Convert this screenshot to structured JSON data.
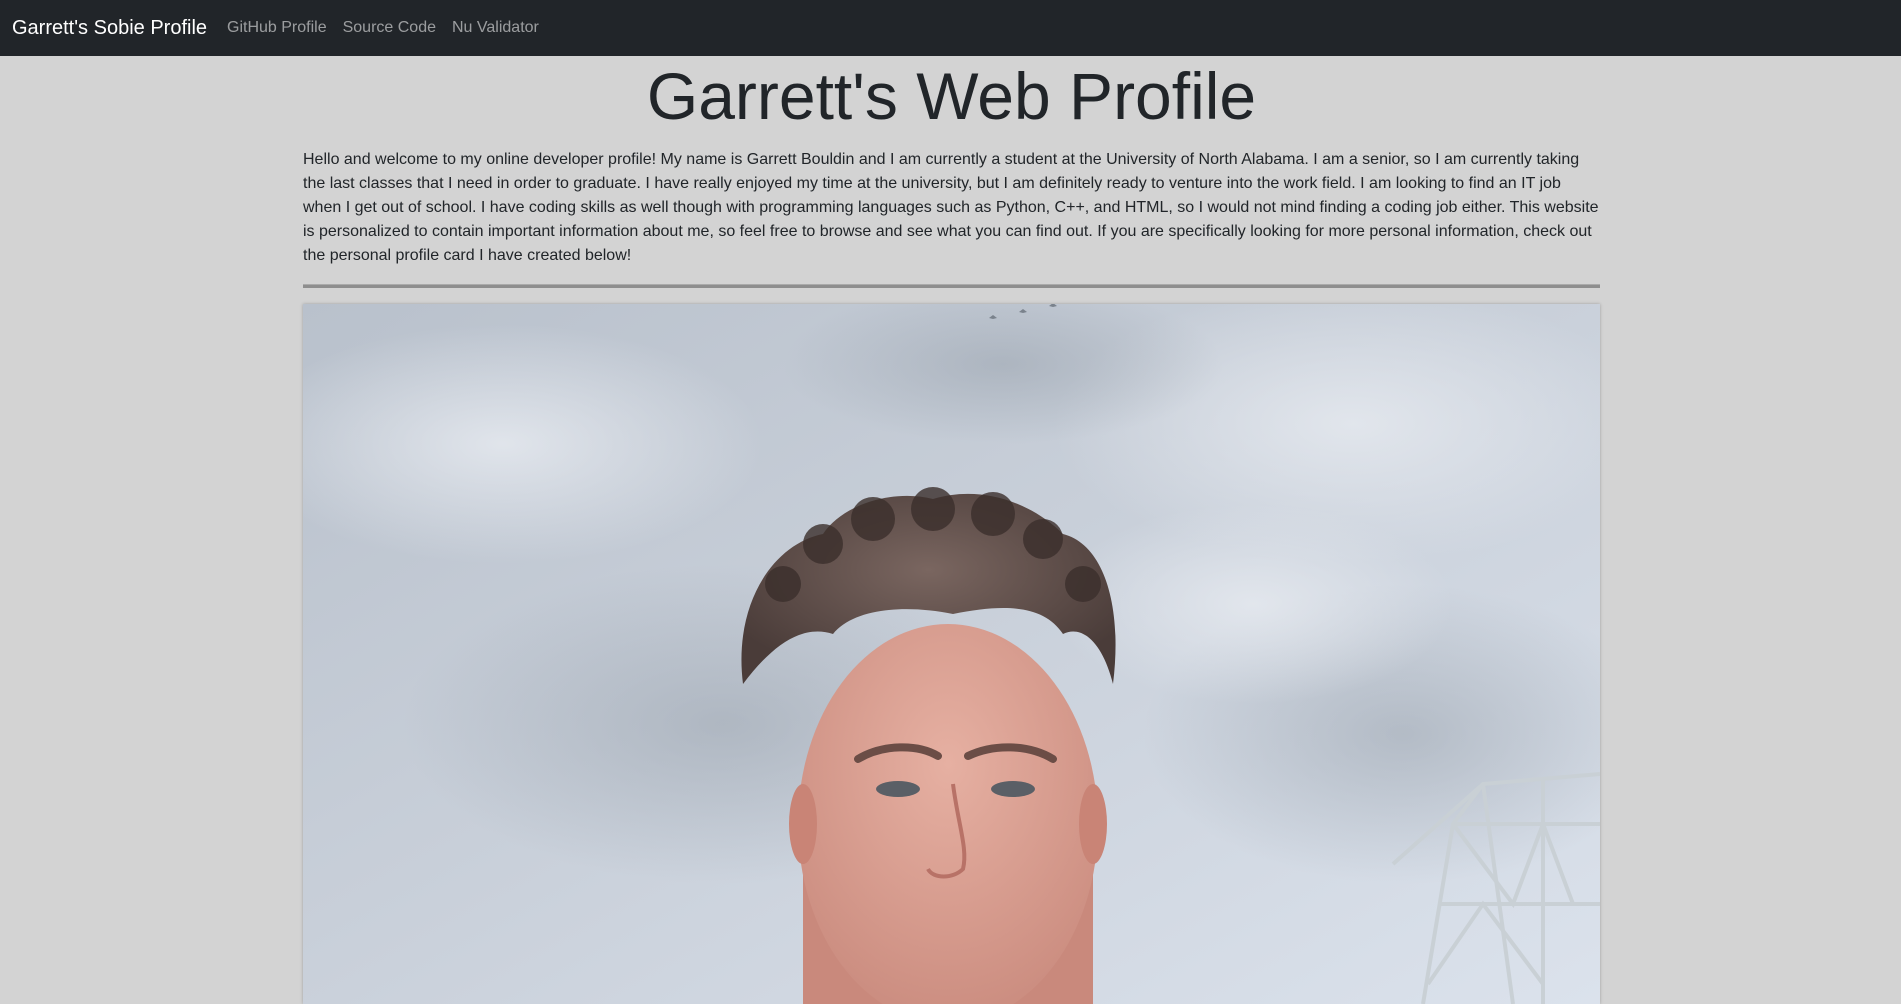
{
  "navbar": {
    "brand": "Garrett's Sobie Profile",
    "links": [
      "GitHub Profile",
      "Source Code",
      "Nu Validator"
    ]
  },
  "main": {
    "title": "Garrett's Web Profile",
    "intro": "Hello and welcome to my online developer profile! My name is Garrett Bouldin and I am currently a student at the University of North Alabama. I am a senior, so I am currently taking the last classes that I need in order to graduate. I have really enjoyed my time at the university, but I am definitely ready to venture into the work field. I am looking to find an IT job when I get out of school. I have coding skills as well though with programming languages such as Python, C++, and HTML, so I would not mind finding a coding job either. This website is personalized to contain important information about me, so feel free to browse and see what you can find out. If you are specifically looking for more personal information, check out the personal profile card I have created below!"
  },
  "colors": {
    "navbar_bg": "#212529",
    "page_bg": "#d3d3d3",
    "text": "#212529"
  }
}
